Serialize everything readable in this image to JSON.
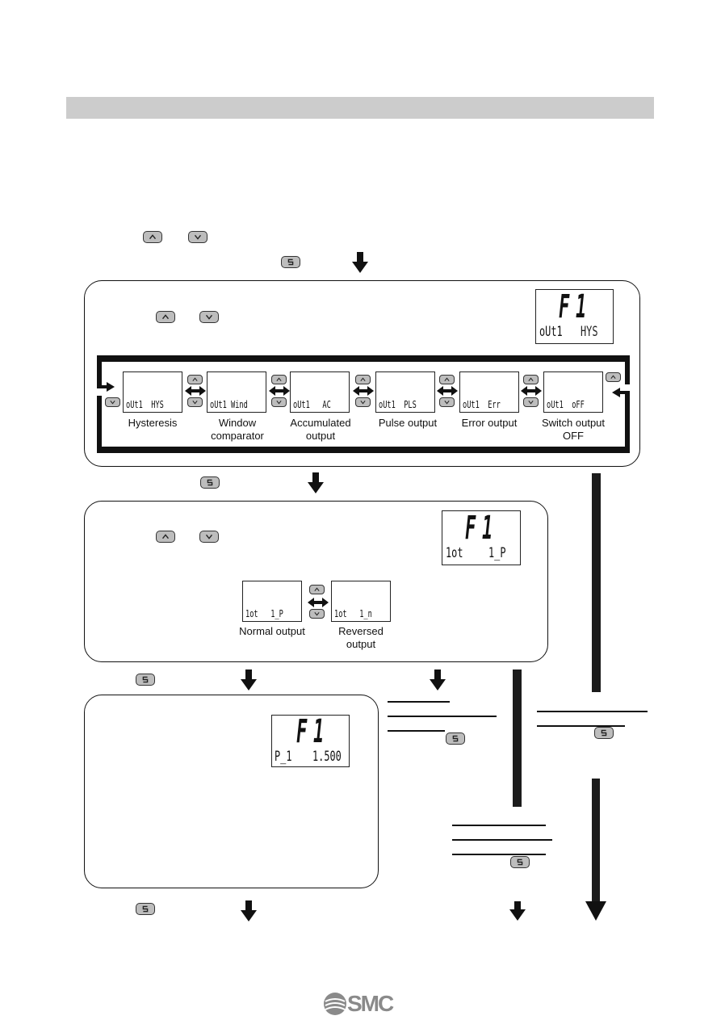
{
  "header": {
    "bar_label": ""
  },
  "icons": {
    "up": "up-button-icon",
    "down": "down-button-icon",
    "set": "S"
  },
  "box1": {
    "lcd": {
      "main": "F1",
      "sub_left": "oUt1",
      "sub_right": "HYS"
    },
    "modes": [
      {
        "display": "oUt1  HYS",
        "label": "Hysteresis"
      },
      {
        "display": "oUt1 Wind",
        "label": "Window comparator"
      },
      {
        "display": "oUt1   AC",
        "label": "Accumulated output"
      },
      {
        "display": "oUt1  PLS",
        "label": "Pulse output"
      },
      {
        "display": "oUt1  Err",
        "label": "Error output"
      },
      {
        "display": "oUt1  oFF",
        "label": "Switch output OFF"
      }
    ]
  },
  "box2": {
    "lcd": {
      "main": "F1",
      "sub_left": "1ot",
      "sub_right": "1_P"
    },
    "options": [
      {
        "display": "1ot   1_P",
        "label": "Normal output"
      },
      {
        "display": "1ot   1_n",
        "label": "Reversed output"
      }
    ]
  },
  "box3": {
    "lcd": {
      "main": "F1",
      "sub_left": "P_1",
      "sub_right": "1.500"
    }
  },
  "footer": {
    "logo": "SMC"
  }
}
